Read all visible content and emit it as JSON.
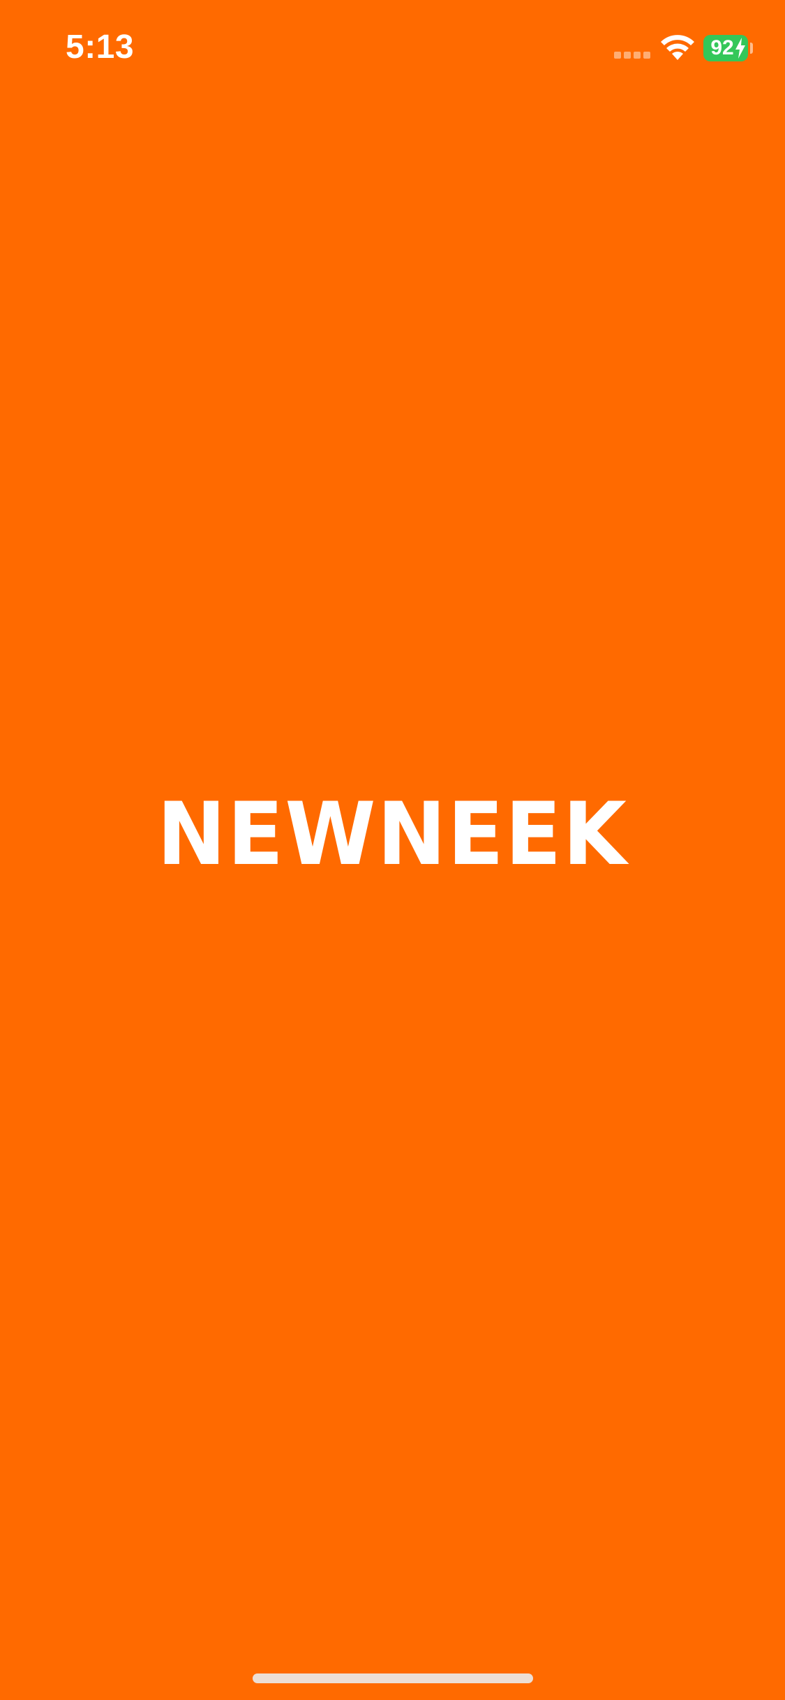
{
  "status_bar": {
    "time": "5:13",
    "battery_level": "92",
    "battery_charging": true,
    "signal_icon": "cellular-signal-icon",
    "wifi_icon": "wifi-icon"
  },
  "splash": {
    "logo_text": "NEWNEEK"
  },
  "colors": {
    "background": "#FF6A00",
    "logo": "#FFFFFF",
    "battery": "#34C759"
  }
}
